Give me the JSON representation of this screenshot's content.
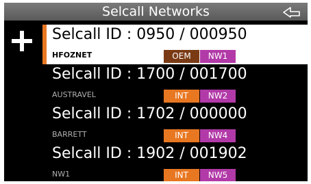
{
  "header": {
    "title": "Selcall Networks",
    "back_icon": "back-arrow-icon",
    "add_icon": "plus-icon"
  },
  "colors": {
    "header_bg": "#6a6a6a",
    "selected_marker": "#e87722",
    "type_badge": "#e87722",
    "type_badge_selected": "#7a3b14",
    "network_badge": "#b23aa8"
  },
  "networks": [
    {
      "title": "Selcall ID : 0950 / 000950",
      "name": "HFOZNET",
      "type": "OEM",
      "network": "NW1",
      "selected": true
    },
    {
      "title": "Selcall ID : 1700 / 001700",
      "name": "AUSTRAVEL",
      "type": "INT",
      "network": "NW2",
      "selected": false
    },
    {
      "title": "Selcall ID : 1702 / 000000",
      "name": "BARRETT",
      "type": "INT",
      "network": "NW4",
      "selected": false
    },
    {
      "title": "Selcall ID : 1902 / 001902",
      "name": "NW1",
      "type": "INT",
      "network": "NW5",
      "selected": false
    }
  ]
}
